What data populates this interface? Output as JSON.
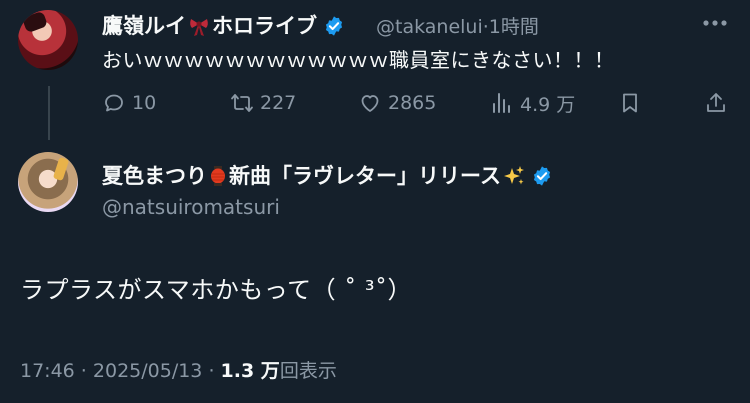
{
  "tweet1": {
    "display_name_prefix": "鷹嶺ルイ",
    "display_name_suffix": "ホロライブ",
    "handle": "@takanelui",
    "time": "·1時間",
    "text": "おいｗｗｗｗｗｗｗｗｗｗｗｗ職員室にきなさい！！！",
    "actions": {
      "replies": "10",
      "retweets": "227",
      "likes": "2865",
      "views": "4.9 万"
    }
  },
  "tweet2": {
    "display_name_prefix": "夏色まつり",
    "display_name_suffix": "新曲「ラヴレター」リリース",
    "handle": "@natsuiromatsuri",
    "text": "ラプラスがスマホかもって（ ˚ ³˚）",
    "time": "17:46",
    "separator": " · ",
    "date": "2025/05/13",
    "separator2": " · ",
    "views_count": "1.3 万",
    "views_label": "回表示"
  },
  "colors": {
    "background": "#15202b",
    "text": "#f7f9f9",
    "muted": "#8b98a5",
    "verified": "#1d9bf0"
  }
}
